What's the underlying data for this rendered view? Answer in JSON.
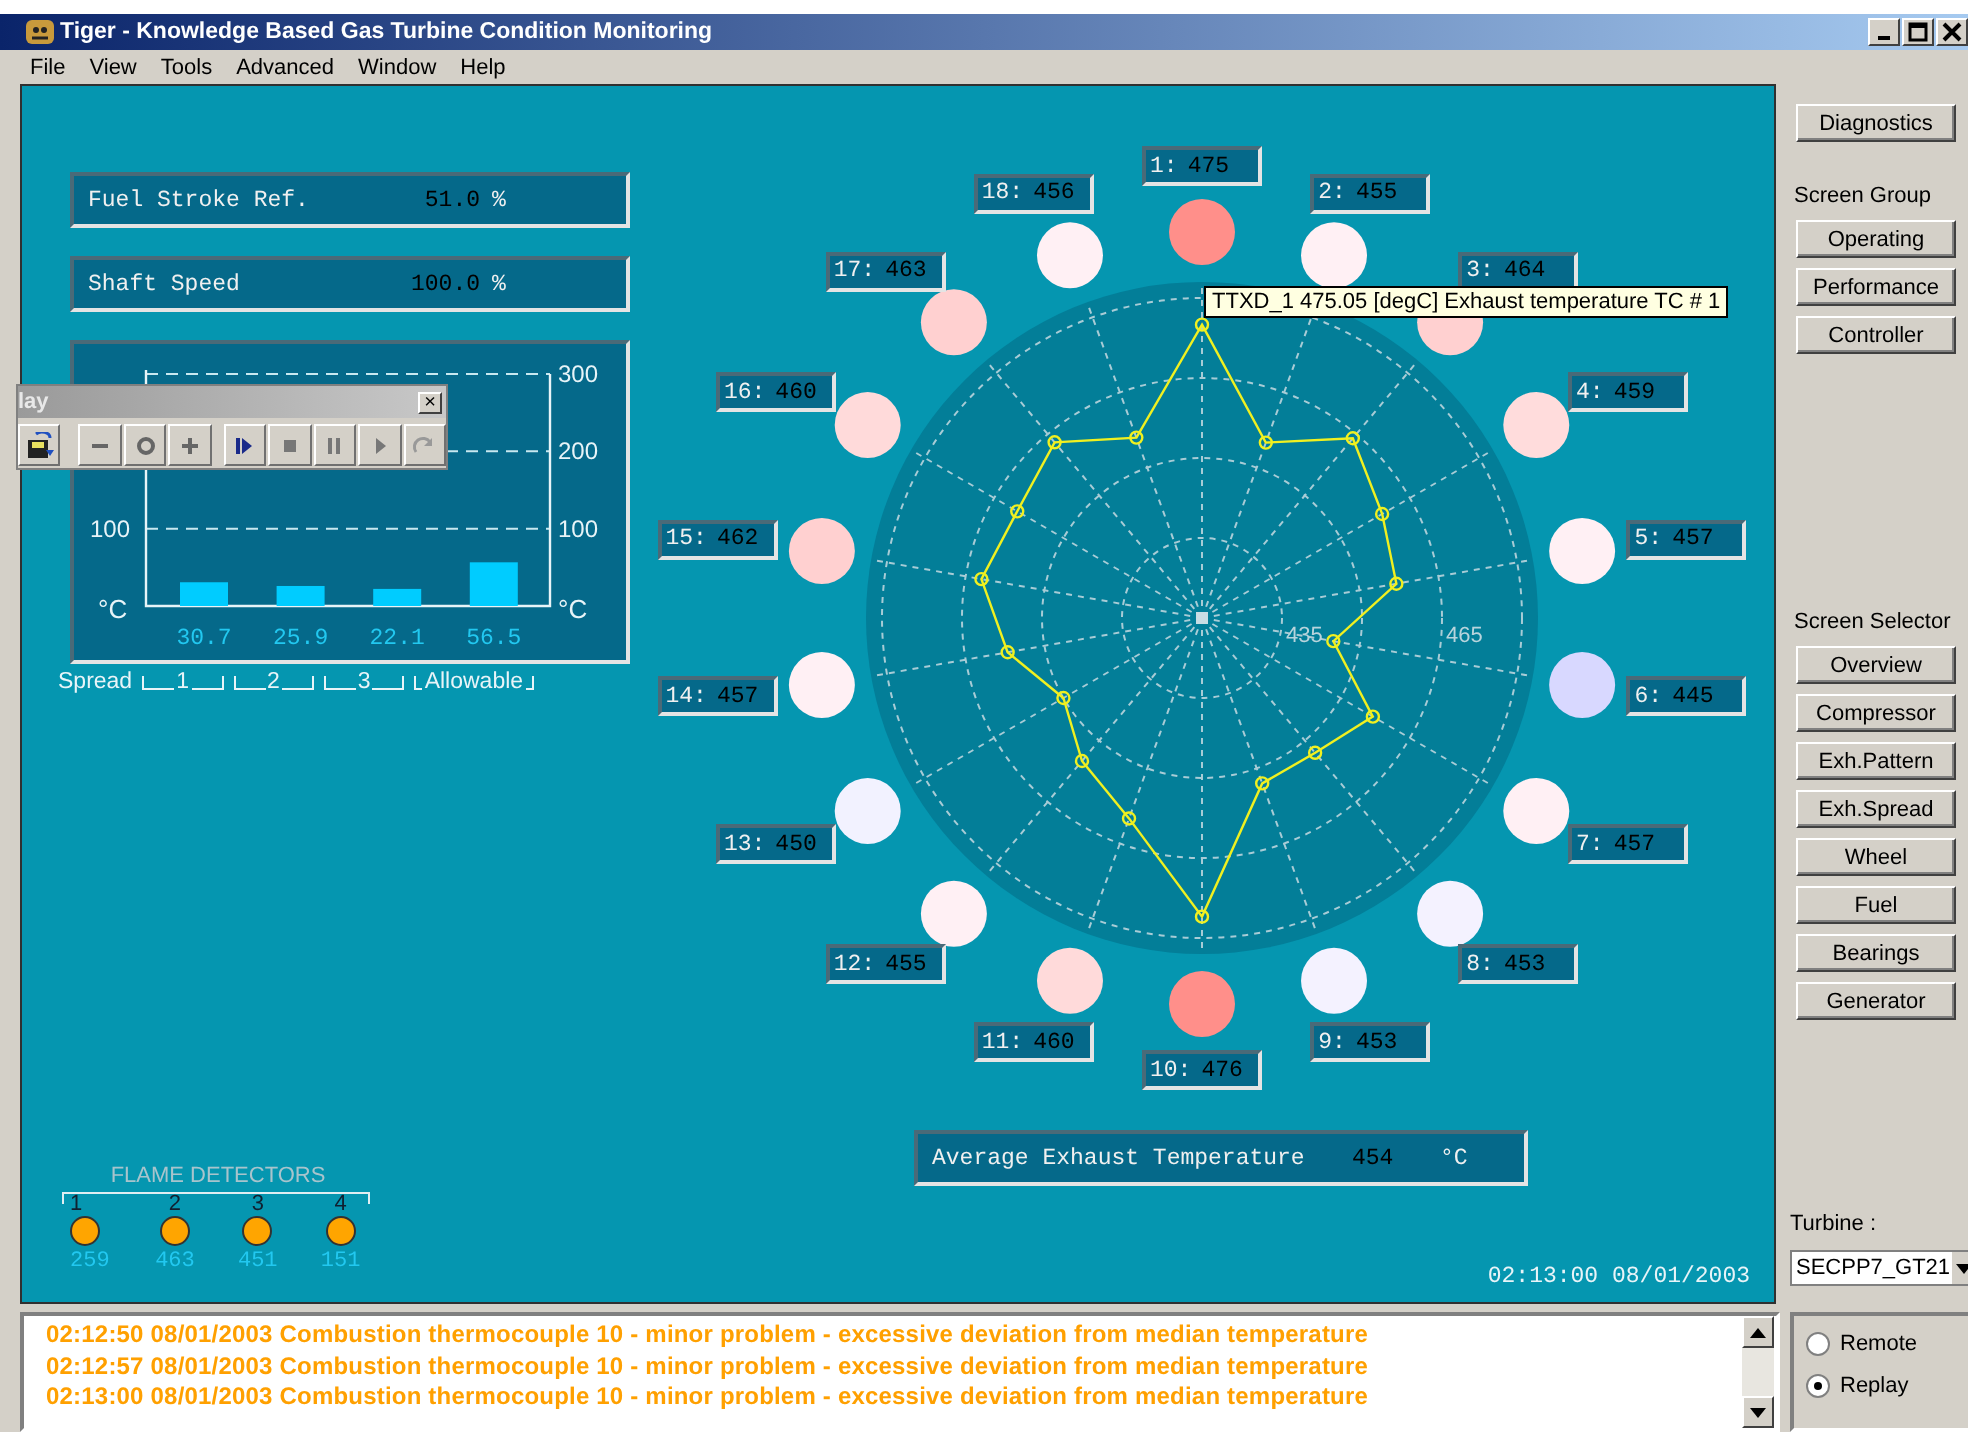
{
  "window": {
    "title": "Tiger - Knowledge Based Gas Turbine Condition Monitoring"
  },
  "menu": [
    "File",
    "View",
    "Tools",
    "Advanced",
    "Window",
    "Help"
  ],
  "readouts": [
    {
      "label": "Fuel Stroke Ref.",
      "value": "51.0",
      "unit": "%"
    },
    {
      "label": "Shaft Speed",
      "value": "100.0",
      "unit": "%"
    }
  ],
  "spread_chart": {
    "chart_data": {
      "type": "bar",
      "values": [
        30.7,
        25.9,
        22.1,
        56.5
      ],
      "ylim": [
        0,
        300
      ],
      "yticks": [
        100,
        200,
        300
      ],
      "ylabel": "°C",
      "data_labels": true
    },
    "left_tick_labels": [
      "100"
    ],
    "unit_right": "°C",
    "legend_title": "Spread",
    "legend_items": [
      "1",
      "2",
      "3",
      "Allowable"
    ]
  },
  "replay_toolbar": {
    "title": "lay",
    "close": "×",
    "buttons": [
      {
        "kind": "save"
      },
      {
        "kind": "minus"
      },
      {
        "kind": "circle"
      },
      {
        "kind": "plus"
      },
      {
        "kind": "step"
      },
      {
        "kind": "stop"
      },
      {
        "kind": "pause"
      },
      {
        "kind": "play"
      },
      {
        "kind": "redo"
      }
    ]
  },
  "thermocouples": [
    {
      "number": "1:",
      "value": "475",
      "color": "#ff8f8a"
    },
    {
      "number": "2:",
      "value": "455",
      "color": "#fff0f4"
    },
    {
      "number": "3:",
      "value": "464",
      "color": "#ffd0d0"
    },
    {
      "number": "4:",
      "value": "459",
      "color": "#ffdcdc"
    },
    {
      "number": "5:",
      "value": "457",
      "color": "#fff0f4"
    },
    {
      "number": "6:",
      "value": "445",
      "color": "#d8d8ff"
    },
    {
      "number": "7:",
      "value": "457",
      "color": "#fff0f4"
    },
    {
      "number": "8:",
      "value": "453",
      "color": "#f4f2ff"
    },
    {
      "number": "9:",
      "value": "453",
      "color": "#f4f2ff"
    },
    {
      "number": "10:",
      "value": "476",
      "color": "#ff8f8a"
    },
    {
      "number": "11:",
      "value": "460",
      "color": "#ffdada"
    },
    {
      "number": "12:",
      "value": "455",
      "color": "#fff0f4"
    },
    {
      "number": "13:",
      "value": "450",
      "color": "#f2f2ff"
    },
    {
      "number": "14:",
      "value": "457",
      "color": "#fff0f4"
    },
    {
      "number": "15:",
      "value": "462",
      "color": "#ffd0d0"
    },
    {
      "number": "16:",
      "value": "460",
      "color": "#ffdada"
    },
    {
      "number": "17:",
      "value": "463",
      "color": "#ffd0d0"
    },
    {
      "number": "18:",
      "value": "456",
      "color": "#fff0f4"
    }
  ],
  "polar": {
    "ring_labels": [
      "435",
      "465"
    ]
  },
  "tooltip": "TTXD_1 475.05 [degC] Exhaust temperature TC # 1",
  "average_exhaust": {
    "label": "Average Exhaust Temperature",
    "value": "454",
    "unit": "°C"
  },
  "timestamp": "02:13:00 08/01/2003",
  "flame_detectors": {
    "title": "FLAME DETECTORS",
    "items": [
      {
        "number": "1",
        "value": "259"
      },
      {
        "number": "2",
        "value": "463"
      },
      {
        "number": "3",
        "value": "451"
      },
      {
        "number": "4",
        "value": "151"
      }
    ]
  },
  "sidebar": {
    "diagnostics": "Diagnostics",
    "screen_group": {
      "label": "Screen Group",
      "buttons": [
        "Operating",
        "Performance",
        "Controller"
      ]
    },
    "screen_selector": {
      "label": "Screen Selector",
      "buttons": [
        "Overview",
        "Compressor",
        "Exh.Pattern",
        "Exh.Spread",
        "Wheel",
        "Fuel",
        "Bearings",
        "Generator"
      ]
    },
    "turbine": {
      "label": "Turbine :",
      "value": "SECPP7_GT21"
    }
  },
  "log": [
    "02:12:50 08/01/2003 Combustion thermocouple 10 - minor problem - excessive deviation from median temperature",
    "02:12:57 08/01/2003 Combustion thermocouple 10 - minor problem - excessive deviation from median temperature",
    "02:13:00 08/01/2003 Combustion thermocouple 10 - minor problem - excessive deviation from median temperature"
  ],
  "mode": [
    {
      "label": "Remote",
      "selected": false
    },
    {
      "label": "Replay",
      "selected": true
    }
  ]
}
